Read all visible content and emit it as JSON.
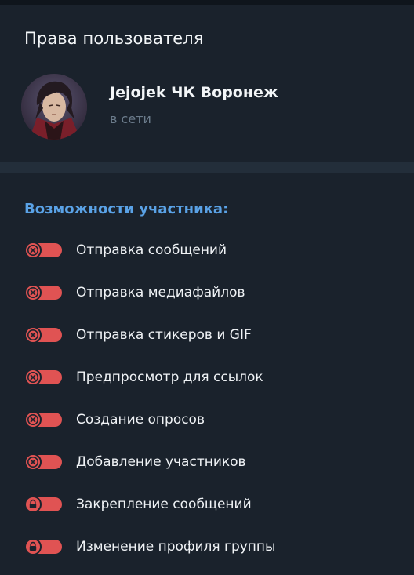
{
  "header": {
    "title": "Права пользователя"
  },
  "user": {
    "name": "Jejojek ЧК Воронеж",
    "status": "в сети"
  },
  "permissions": {
    "section_title": "Возможности участника:",
    "items": [
      {
        "label": "Отправка сообщений",
        "state": "off",
        "icon": "cross-icon"
      },
      {
        "label": "Отправка медиафайлов",
        "state": "off",
        "icon": "cross-icon"
      },
      {
        "label": "Отправка стикеров и GIF",
        "state": "off",
        "icon": "cross-icon"
      },
      {
        "label": "Предпросмотр для ссылок",
        "state": "off",
        "icon": "cross-icon"
      },
      {
        "label": "Создание опросов",
        "state": "off",
        "icon": "cross-icon"
      },
      {
        "label": "Добавление участников",
        "state": "off",
        "icon": "cross-icon"
      },
      {
        "label": "Закрепление сообщений",
        "state": "locked",
        "icon": "lock-icon"
      },
      {
        "label": "Изменение профиля группы",
        "state": "locked",
        "icon": "lock-icon"
      }
    ]
  },
  "colors": {
    "background": "#1a222c",
    "accent": "#5aa2e6",
    "toggle_off": "#e05353",
    "status_text": "#6b7b8b"
  }
}
